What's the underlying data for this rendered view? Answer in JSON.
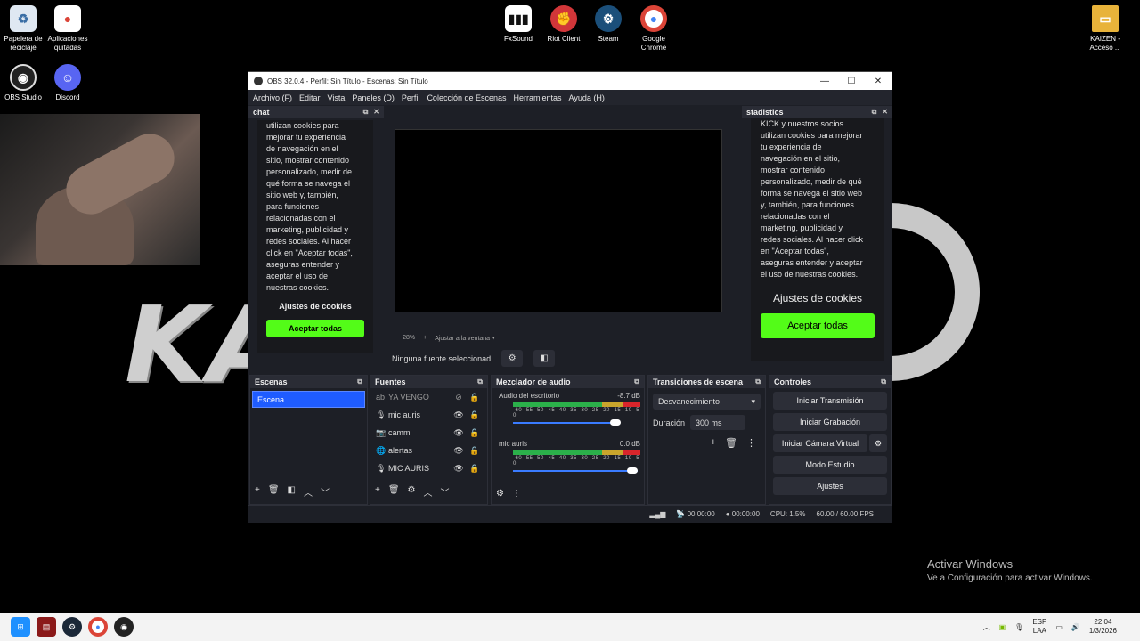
{
  "desktop": {
    "icons_left": [
      {
        "label": "Papelera de reciclaje",
        "icon": "recycle-bin-icon"
      },
      {
        "label": "Aplicaciones quitadas",
        "icon": "chrome-icon"
      },
      {
        "label": "OBS Studio",
        "icon": "obs-icon"
      },
      {
        "label": "Discord",
        "icon": "discord-icon"
      }
    ],
    "icons_top": [
      {
        "label": "FxSound",
        "icon": "fxsound-icon"
      },
      {
        "label": "Riot Client",
        "icon": "riot-icon"
      },
      {
        "label": "Steam",
        "icon": "steam-icon"
      },
      {
        "label": "Google Chrome",
        "icon": "chrome-icon"
      }
    ],
    "icon_right": {
      "label": "KAIZEN - Acceso ...",
      "icon": "folder-icon"
    },
    "wallpaper_text": "KA",
    "activate_title": "Activar Windows",
    "activate_sub": "Ve a Configuración para activar Windows."
  },
  "obs": {
    "title": "OBS 32.0.4 - Perfil: Sin Título - Escenas: Sin Título",
    "menu": [
      "Archivo (F)",
      "Editar",
      "Vista",
      "Paneles (D)",
      "Perfil",
      "Colección de Escenas",
      "Herramientas",
      "Ayuda (H)"
    ],
    "chat": {
      "title": "chat",
      "cookie_text": "utilizan cookies para\nmejorar tu experiencia\nde navegación en el\nsitio, mostrar contenido\npersonalizado, medir de\nqué forma se navega el\nsitio web y, también,\npara funciones\nrelacionadas con el\nmarketing, publicidad y\nredes sociales. Al hacer\nclick en \"Aceptar todas\",\naseguras entender y\naceptar el uso de\nnuestras cookies.",
      "settings": "Ajustes de cookies",
      "accept": "Aceptar todas"
    },
    "stats": {
      "title": "stadistics",
      "cookie_text": "KICK y nuestros socios\nutilizan cookies para mejorar\ntu experiencia de\nnavegación en el sitio,\nmostrar contenido\npersonalizado, medir de qué\nforma se navega el sitio web\ny, también, para funciones\nrelacionadas con el\nmarketing, publicidad y\nredes sociales. Al hacer click\nen \"Aceptar todas\",\naseguras entender y aceptar\nel uso de nuestras cookies.",
      "settings": "Ajustes de cookies",
      "accept": "Aceptar todas"
    },
    "zoom": {
      "minus": "−",
      "value": "28%",
      "plus": "+",
      "fit": "Ajustar a la ventana"
    },
    "no_source": "Ninguna fuente seleccionad",
    "scenes": {
      "title": "Escenas",
      "items": [
        "Escena"
      ]
    },
    "sources": {
      "title": "Fuentes",
      "items": [
        {
          "name": "YA VENGO",
          "icon": "text-icon",
          "visible": false
        },
        {
          "name": "mic auris",
          "icon": "mic-icon",
          "visible": true
        },
        {
          "name": "camm",
          "icon": "camera-icon",
          "visible": true
        },
        {
          "name": "alertas",
          "icon": "browser-icon",
          "visible": true
        },
        {
          "name": "MIC AURIS",
          "icon": "mic-icon",
          "visible": true
        }
      ]
    },
    "mixer": {
      "title": "Mezclador de audio",
      "channels": [
        {
          "name": "Audio del escritorio",
          "db": "-8.7 dB",
          "volume": 0.82
        },
        {
          "name": "mic auris",
          "db": "0.0 dB",
          "volume": 1.0
        }
      ],
      "ticks": "-60 -55 -50 -45 -40 -35 -30 -25 -20 -15 -10 -5 0"
    },
    "transitions": {
      "title": "Transiciones de escena",
      "selected": "Desvanecimiento",
      "duration_label": "Duración",
      "duration": "300 ms"
    },
    "controls": {
      "title": "Controles",
      "buttons": [
        "Iniciar Transmisión",
        "Iniciar Grabación",
        "Iniciar Cámara Virtual",
        "Modo Estudio",
        "Ajustes"
      ]
    },
    "status": {
      "stream_time": "00:00:00",
      "rec_time": "00:00:00",
      "cpu": "CPU: 1.5%",
      "fps": "60.00 / 60.00 FPS"
    }
  },
  "taskbar": {
    "lang1": "ESP",
    "lang2": "LAA",
    "time": "22:04",
    "date": "1/3/2026"
  }
}
